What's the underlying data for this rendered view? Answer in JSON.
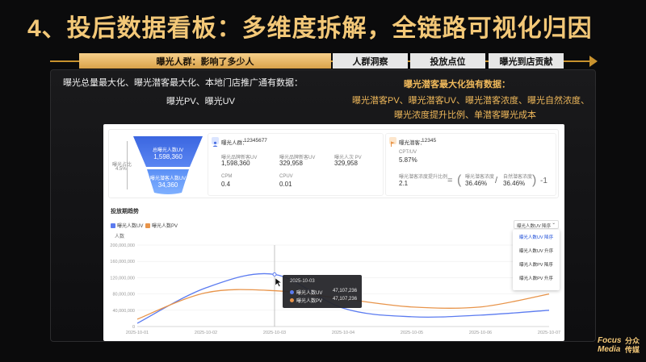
{
  "title": "4、投后数据看板：多维度拆解，全链路可视化归因",
  "tabs": [
    {
      "label": "曝光人群：影响了多少人"
    },
    {
      "label": "人群洞察"
    },
    {
      "label": "投放点位"
    },
    {
      "label": "曝光到店贡献"
    }
  ],
  "left_note": {
    "line1": "曝光总量最大化、曝光潜客最大化、本地门店推广通有数据：",
    "line2": "曝光PV、曝光UV"
  },
  "right_note": {
    "head": "曝光潜客最大化独有数据：",
    "line1": "曝光潜客PV、曝光潜客UV、曝光潜客浓度、曝光自然浓度、",
    "line2": "曝光浓度提升比例、单潜客曝光成本"
  },
  "dashboard": {
    "funnel": {
      "side_label": "曝光占比",
      "side_pct": "4.5%",
      "top_label": "总曝光人数UV",
      "top_value": "1,598,360",
      "bottom_label": "曝光潜客人数UV",
      "bottom_value": "34,360"
    },
    "crowd_card": {
      "header_label": "曝光人群：",
      "header_value": "12345677",
      "metrics": [
        {
          "label": "曝光品牌新客UV",
          "value": "1,598,360"
        },
        {
          "label": "曝光品牌新客UV",
          "value": "329,958"
        },
        {
          "label": "曝光人次 PV",
          "value": "329,958"
        },
        {
          "label": "CPM",
          "value": "0.4"
        },
        {
          "label": "CPUV",
          "value": "0.01"
        }
      ]
    },
    "potential_card": {
      "header_label": "曝光潜客：",
      "header_value": "12345",
      "cpt_label": "CPT/UV",
      "cpt_value": "5.87%",
      "lift_label": "曝光潜客浓度提升比例",
      "lift_value": "2.1",
      "eq": "=",
      "open_paren": "(",
      "close_paren": ")",
      "slash": "/",
      "minus_one": "-1",
      "num_label": "曝光潜客浓度",
      "num_value": "36.46%",
      "den_label": "自然潜客浓度",
      "den_value": "36.46%"
    },
    "trend": {
      "title": "投放期趋势",
      "legend_uv": "曝光人数UV",
      "legend_pv": "曝光人数PV",
      "y_title": "人数",
      "select_value": "曝光人数UV 降序",
      "select_arrow": "⌄",
      "dropdown": [
        {
          "label": "曝光人数UV 降序"
        },
        {
          "label": "曝光人数UV 升序"
        },
        {
          "label": "曝光人数PV 降序"
        },
        {
          "label": "曝光人数PV 升序"
        }
      ],
      "tooltip": {
        "date": "2025-10-03",
        "rows": [
          {
            "label": "曝光人数UV",
            "value": "47,107,236"
          },
          {
            "label": "曝光人数PV",
            "value": "47,107,236"
          }
        ]
      }
    }
  },
  "chart_data": {
    "type": "line",
    "x": [
      "2025-10-01",
      "2025-10-02",
      "2025-10-03",
      "2025-10-04",
      "2025-10-05",
      "2025-10-06",
      "2025-10-07"
    ],
    "yticks": [
      "200,000,000",
      "160,000,000",
      "120,000,000",
      "80,000,000",
      "40,000,000",
      "0"
    ],
    "ylim": [
      0,
      200000000
    ],
    "series": [
      {
        "name": "曝光人数UV",
        "color": "#5b7bf0",
        "values": [
          8000000,
          95000000,
          128000000,
          45000000,
          24000000,
          28000000,
          40000000
        ]
      },
      {
        "name": "曝光人数PV",
        "color": "#e8944a",
        "values": [
          18000000,
          83000000,
          88000000,
          68000000,
          48000000,
          48000000,
          80000000
        ]
      }
    ]
  },
  "logo": {
    "brand_top": "Focus",
    "brand_bottom": "Media",
    "cn_top": "分众",
    "cn_bottom": "传媒"
  },
  "colors": {
    "accent": "#f3c878",
    "uv": "#5b7bf0",
    "pv": "#e8944a"
  }
}
